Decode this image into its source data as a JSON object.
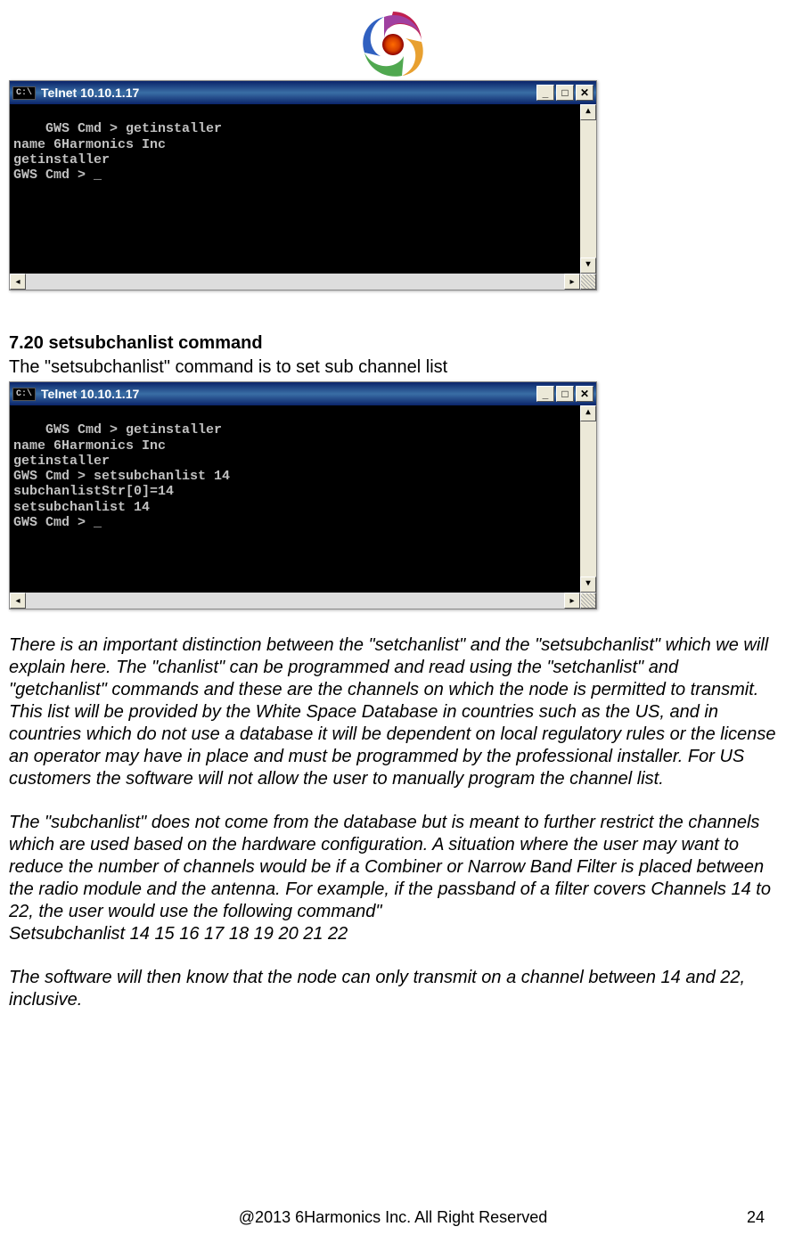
{
  "window1": {
    "icon_text": "C:\\",
    "title": "Telnet 10.10.1.17",
    "terminal_text": "GWS Cmd > getinstaller\nname 6Harmonics Inc\ngetinstaller\nGWS Cmd > _"
  },
  "section": {
    "heading": "7.20   setsubchanlist  command",
    "intro": "The \"setsubchanlist\" command is to set sub channel list"
  },
  "window2": {
    "icon_text": "C:\\",
    "title": "Telnet 10.10.1.17",
    "terminal_text": "GWS Cmd > getinstaller\nname 6Harmonics Inc\ngetinstaller\nGWS Cmd > setsubchanlist 14\nsubchanlistStr[0]=14\nsetsubchanlist 14\nGWS Cmd > _"
  },
  "body": {
    "p1": "There is an important distinction between the \"setchanlist\"   and the \"setsubchanlist\" which we will explain here.   The \"chanlist\"  can be programmed and read using the \"setchanlist\" and \"getchanlist\" commands and these are the channels on which the node is permitted to transmit.   This list will be provided by the White Space Database in countries such as the US,  and in countries which do not use a database it will be dependent on local regulatory rules or the license an operator may have in place and must be programmed by the professional installer.   For US customers the software will not allow the user to manually program the channel list.",
    "p2": "The \"subchanlist\" does not come from the database but is meant to further restrict the channels which are used based on the hardware configuration.   A situation where the user may want to reduce the number of channels would be if a Combiner or Narrow Band Filter is placed between the radio module and the antenna.    For example,  if the passband of a  filter covers Channels 14 to 22,    the user would use the following command\"",
    "p2b": "Setsubchanlist 14 15 16 17 18 19 20 21 22",
    "p3": "The software will then know that the node can only transmit on a channel between 14 and 22, inclusive."
  },
  "footer": {
    "copyright": "@2013 6Harmonics Inc. All Right Reserved",
    "page": "24"
  }
}
